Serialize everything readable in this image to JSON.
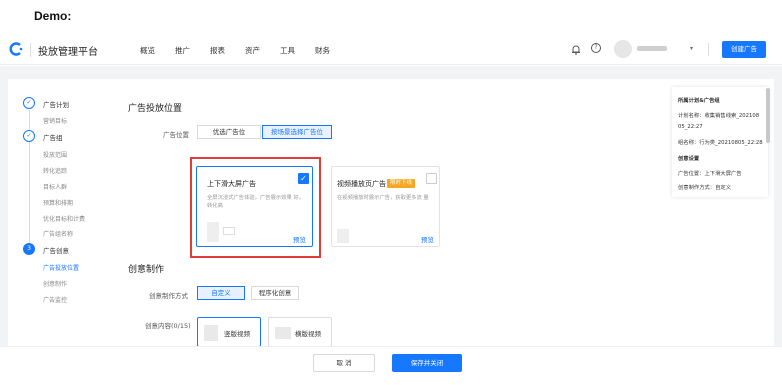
{
  "demo_label": "Demo:",
  "header": {
    "brand": "投放管理平台",
    "nav": [
      "概览",
      "推广",
      "报表",
      "资产",
      "工具",
      "财务"
    ],
    "create_button": "创建广告"
  },
  "steps": [
    {
      "label": "广告计划",
      "subs": [
        "营销目标"
      ]
    },
    {
      "label": "广告组",
      "subs": [
        "投放范围",
        "转化追踪",
        "目标人群",
        "预算和排期",
        "优化目标和计费",
        "广告组名称"
      ]
    },
    {
      "label": "广告创意",
      "num": "3",
      "subs": [
        "广告投放位置",
        "创意制作",
        "广告监控"
      ],
      "active_sub": "广告投放位置"
    }
  ],
  "placement": {
    "section_title": "广告投放位置",
    "field_label": "广告位置",
    "options": [
      "优选广告位",
      "按场景选择广告位"
    ],
    "selected_option": "按场景选择广告位",
    "cards": [
      {
        "title": "上下滑大屏广告",
        "desc": "全屏沉浸式广告体验，广告展示效果 好，转化高",
        "preview": "预览",
        "checked": true
      },
      {
        "title": "视频播放页广告",
        "badge": "限时下线",
        "desc": "在视频播放时展示广告，获取更多流 量",
        "preview": "预览",
        "checked": false
      }
    ]
  },
  "creative": {
    "section_title": "创意制作",
    "method_label": "创意制作方式",
    "methods": [
      "自定义",
      "程序化创意"
    ],
    "selected_method": "自定义",
    "content_label": "创意内容(0/15)",
    "media": [
      "竖版视频",
      "横版视频"
    ]
  },
  "info_panel": {
    "title": "所属计划&广告组",
    "plan_name_label": "计划名称：",
    "plan_name_value": "收集销售线索_202108",
    "plan_name_value2": "05_22:27",
    "group_name_label": "组名称：",
    "group_name_value": "行为类_20210805_22:28",
    "creative_title": "创意设置",
    "position_label": "广告位置：",
    "position_value": "上下滑大屏广告",
    "method_label": "创意制作方式：",
    "method_value": "自定义"
  },
  "footer": {
    "cancel": "取 消",
    "save": "保存并关闭"
  },
  "colors": {
    "accent": "#1677ff",
    "highlight": "#e23b3b",
    "badge": "#f5a623"
  },
  "icons": [
    "logo-icon",
    "bell-icon",
    "help-icon",
    "avatar",
    "chevron-down-icon",
    "check-icon",
    "play-icon"
  ]
}
